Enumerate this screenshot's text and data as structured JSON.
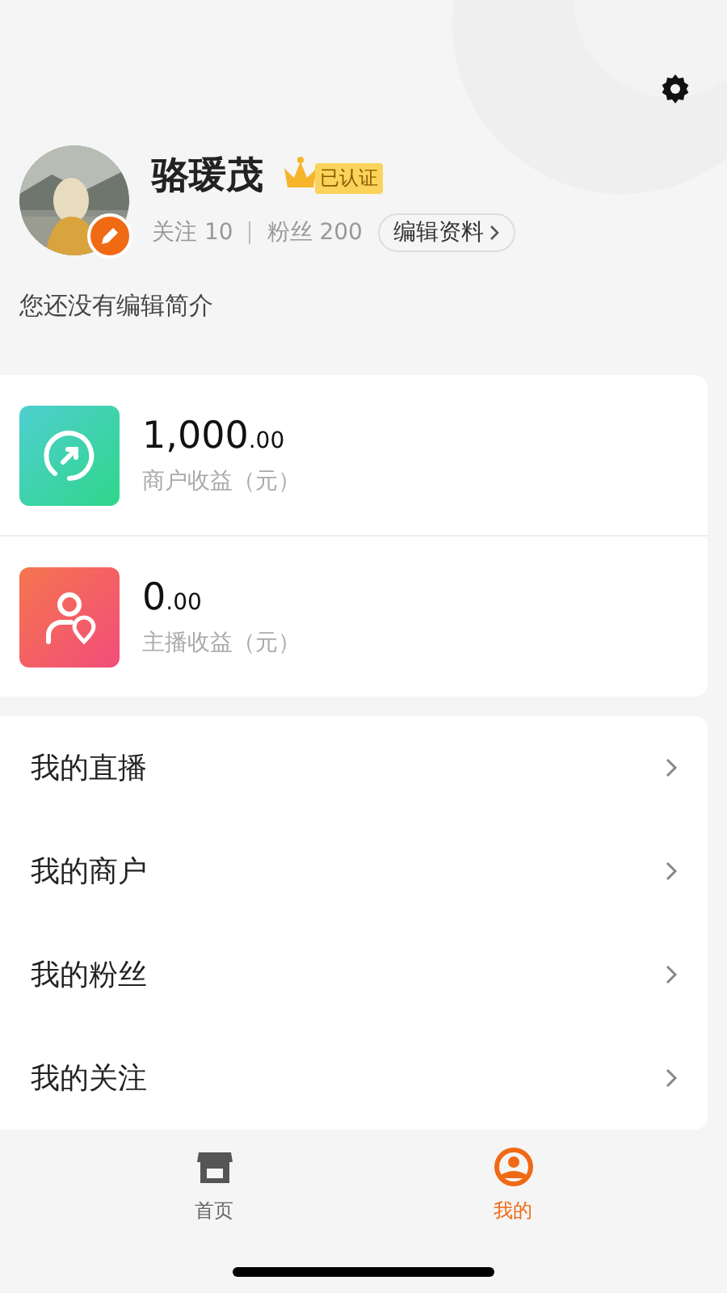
{
  "profile": {
    "name": "骆瑗茂",
    "verified_badge": "已认证",
    "following": "关注 10",
    "followers": "粉丝 200",
    "edit_profile": "编辑资料",
    "bio": "您还没有编辑简介"
  },
  "earnings": [
    {
      "kind": "merchant",
      "amount": "1,000",
      "decimals": ".00",
      "label": "商户收益（元）"
    },
    {
      "kind": "anchor",
      "amount": "0",
      "decimals": ".00",
      "label": "主播收益（元）"
    }
  ],
  "menu": [
    "我的直播",
    "我的商户",
    "我的粉丝",
    "我的关注"
  ],
  "tabs": [
    {
      "kind": "store",
      "label": "首页",
      "selected": false
    },
    {
      "kind": "profile",
      "label": "我的",
      "selected": true
    }
  ]
}
